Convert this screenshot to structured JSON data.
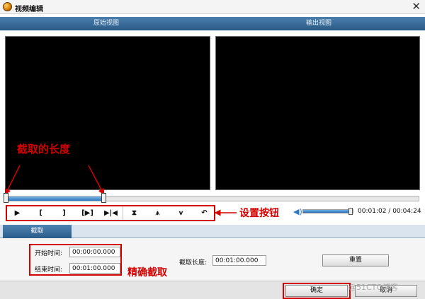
{
  "window": {
    "title": "视频编辑",
    "close_glyph": "✕"
  },
  "views": {
    "original": "原始视图",
    "output": "输出视图"
  },
  "annotations": {
    "clip_length": "截取的长度",
    "control_buttons": "设置按钮",
    "precise_cut": "精确截取"
  },
  "timeline": {
    "progress": 0.24
  },
  "controls": [
    {
      "name": "play-button",
      "glyph": "▶"
    },
    {
      "name": "mark-in-button",
      "glyph": "["
    },
    {
      "name": "mark-out-button",
      "glyph": "]"
    },
    {
      "name": "play-selection-button",
      "glyph": "[▶]"
    },
    {
      "name": "goto-start-end-button",
      "glyph": "▶|◀"
    },
    {
      "name": "trim-button",
      "glyph": "⧗"
    },
    {
      "name": "move-up-button",
      "glyph": "⩚"
    },
    {
      "name": "move-down-button",
      "glyph": "⩛"
    },
    {
      "name": "undo-button",
      "glyph": "↶"
    }
  ],
  "playback": {
    "current": "00:01:02",
    "separator": " / ",
    "total": "00:04:24",
    "volume": 0.92
  },
  "tabs": {
    "clip": "截取"
  },
  "clip": {
    "start_label": "开始时间:",
    "start_value": "00:00:00.000",
    "end_label": "结束时间:",
    "end_value": "00:01:00.000",
    "length_label": "截取长度:",
    "length_value": "00:01:00.000",
    "reset_label": "重置"
  },
  "footer": {
    "ok_label": "确定",
    "cancel_label": "取消",
    "watermark": "@51CTO博客"
  },
  "colors": {
    "annotation_red": "#d40000",
    "header_blue": "#2a5a86",
    "timeline_blue": "#2e78bf"
  }
}
